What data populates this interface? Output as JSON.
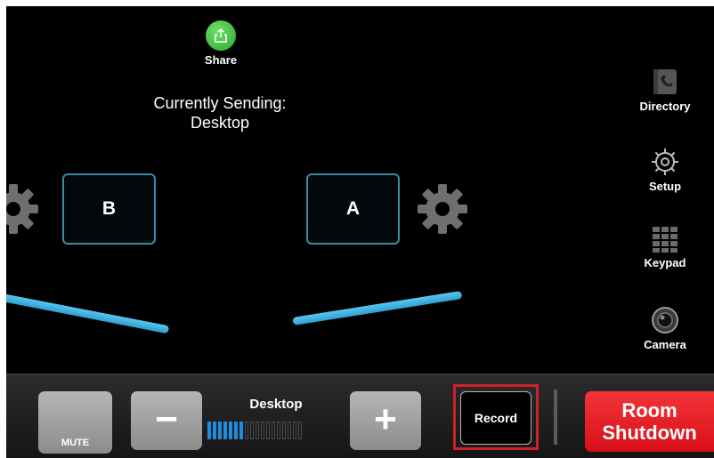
{
  "share": {
    "label": "Share",
    "icon": "share-icon",
    "color": "#35b230"
  },
  "status": {
    "line1": "Currently Sending:",
    "line2": "Desktop"
  },
  "displays": [
    {
      "label": "B"
    },
    {
      "label": "A"
    }
  ],
  "side_menu": {
    "directory": "Directory",
    "setup": "Setup",
    "keypad": "Keypad",
    "camera": "Camera"
  },
  "bottom_bar": {
    "mute_label": "MUTE",
    "minus_symbol": "−",
    "plus_symbol": "+",
    "source_label": "Desktop",
    "volume_level": {
      "filled": 7,
      "total": 18
    },
    "record_label": "Record",
    "shutdown_line1": "Room",
    "shutdown_line2": "Shutdown"
  },
  "colors": {
    "accent_blue": "#3aa9dc",
    "shutdown_red": "#e8161d",
    "highlight_red": "#d0202a"
  }
}
